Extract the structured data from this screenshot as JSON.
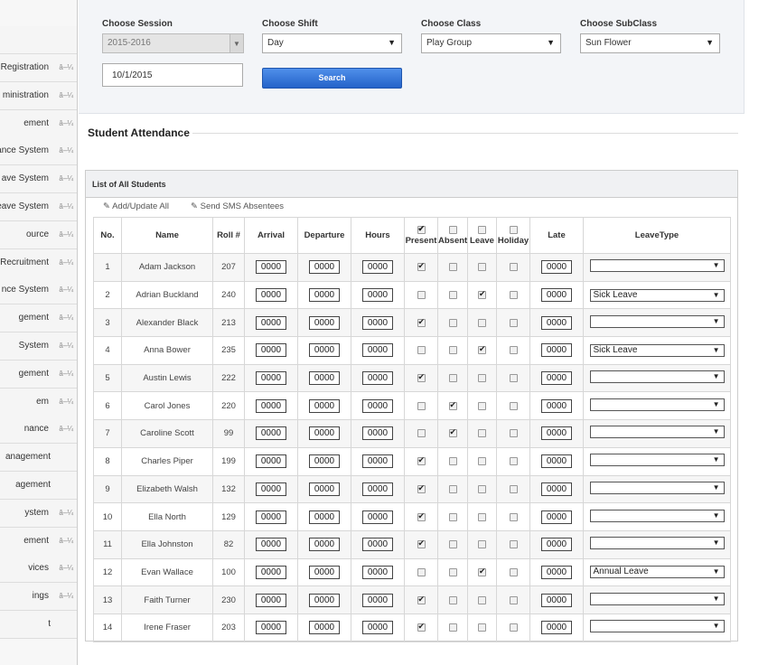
{
  "sidebar": {
    "items": [
      {
        "label": "Registration",
        "arrow": "â–¼"
      },
      {
        "label": "ministration",
        "arrow": "â–¼"
      },
      {
        "label": "ement",
        "arrow": "â–¼"
      },
      {
        "label": "endance System",
        "arrow": "â–¼"
      },
      {
        "label": "ave System",
        "arrow": "â–¼"
      },
      {
        "label": "eave System",
        "arrow": "â–¼"
      },
      {
        "label": "ource",
        "arrow": "â–¼"
      },
      {
        "label": "Recruitment",
        "arrow": "â–¼"
      },
      {
        "label": "nce System",
        "arrow": "â–¼"
      },
      {
        "label": "gement",
        "arrow": "â–¼"
      },
      {
        "label": "System",
        "arrow": "â–¼"
      },
      {
        "label": "gement",
        "arrow": "â–¼"
      },
      {
        "label": "em",
        "arrow": "â–¼"
      },
      {
        "label": "nance",
        "arrow": "â–¼"
      },
      {
        "label": "anagement",
        "arrow": ""
      },
      {
        "label": "agement",
        "arrow": ""
      },
      {
        "label": "ystem",
        "arrow": "â–¼"
      },
      {
        "label": "ement",
        "arrow": "â–¼"
      },
      {
        "label": "vices",
        "arrow": "â–¼"
      },
      {
        "label": "ings",
        "arrow": "â–¼"
      },
      {
        "label": "t",
        "arrow": ""
      }
    ]
  },
  "filters": {
    "session_label": "Choose Session",
    "session_value": "2015-2016",
    "shift_label": "Choose Shift",
    "shift_value": "Day",
    "class_label": "Choose Class",
    "class_value": "Play Group",
    "subclass_label": "Choose SubClass",
    "subclass_value": "Sun Flower",
    "date_value": "10/1/2015",
    "search_label": "Search"
  },
  "page_title": "Student Attendance",
  "card": {
    "title": "List of All Students",
    "add_update": "Add/Update All",
    "send_sms": "Send SMS Absentees"
  },
  "table": {
    "headers": {
      "no": "No.",
      "name": "Name",
      "roll": "Roll #",
      "arrival": "Arrival",
      "departure": "Departure",
      "hours": "Hours",
      "present": "Present",
      "absent": "Absent",
      "leave": "Leave",
      "holiday": "Holiday",
      "late": "Late",
      "leavetype": "LeaveType"
    },
    "header_checks": {
      "present": true,
      "absent": false,
      "leave": false,
      "holiday": false
    },
    "rows": [
      {
        "no": "1",
        "name": "Adam Jackson",
        "roll": "207",
        "arrival": "0000",
        "departure": "0000",
        "hours": "0000",
        "present": true,
        "absent": false,
        "leave": false,
        "holiday": false,
        "late": "0000",
        "leave_type": ""
      },
      {
        "no": "2",
        "name": "Adrian Buckland",
        "roll": "240",
        "arrival": "0000",
        "departure": "0000",
        "hours": "0000",
        "present": false,
        "absent": false,
        "leave": true,
        "holiday": false,
        "late": "0000",
        "leave_type": "Sick Leave"
      },
      {
        "no": "3",
        "name": "Alexander Black",
        "roll": "213",
        "arrival": "0000",
        "departure": "0000",
        "hours": "0000",
        "present": true,
        "absent": false,
        "leave": false,
        "holiday": false,
        "late": "0000",
        "leave_type": ""
      },
      {
        "no": "4",
        "name": "Anna Bower",
        "roll": "235",
        "arrival": "0000",
        "departure": "0000",
        "hours": "0000",
        "present": false,
        "absent": false,
        "leave": true,
        "holiday": false,
        "late": "0000",
        "leave_type": "Sick Leave"
      },
      {
        "no": "5",
        "name": "Austin Lewis",
        "roll": "222",
        "arrival": "0000",
        "departure": "0000",
        "hours": "0000",
        "present": true,
        "absent": false,
        "leave": false,
        "holiday": false,
        "late": "0000",
        "leave_type": ""
      },
      {
        "no": "6",
        "name": "Carol Jones",
        "roll": "220",
        "arrival": "0000",
        "departure": "0000",
        "hours": "0000",
        "present": false,
        "absent": true,
        "leave": false,
        "holiday": false,
        "late": "0000",
        "leave_type": ""
      },
      {
        "no": "7",
        "name": "Caroline Scott",
        "roll": "99",
        "arrival": "0000",
        "departure": "0000",
        "hours": "0000",
        "present": false,
        "absent": true,
        "leave": false,
        "holiday": false,
        "late": "0000",
        "leave_type": ""
      },
      {
        "no": "8",
        "name": "Charles Piper",
        "roll": "199",
        "arrival": "0000",
        "departure": "0000",
        "hours": "0000",
        "present": true,
        "absent": false,
        "leave": false,
        "holiday": false,
        "late": "0000",
        "leave_type": ""
      },
      {
        "no": "9",
        "name": "Elizabeth Walsh",
        "roll": "132",
        "arrival": "0000",
        "departure": "0000",
        "hours": "0000",
        "present": true,
        "absent": false,
        "leave": false,
        "holiday": false,
        "late": "0000",
        "leave_type": ""
      },
      {
        "no": "10",
        "name": "Ella North",
        "roll": "129",
        "arrival": "0000",
        "departure": "0000",
        "hours": "0000",
        "present": true,
        "absent": false,
        "leave": false,
        "holiday": false,
        "late": "0000",
        "leave_type": ""
      },
      {
        "no": "11",
        "name": "Ella Johnston",
        "roll": "82",
        "arrival": "0000",
        "departure": "0000",
        "hours": "0000",
        "present": true,
        "absent": false,
        "leave": false,
        "holiday": false,
        "late": "0000",
        "leave_type": ""
      },
      {
        "no": "12",
        "name": "Evan Wallace",
        "roll": "100",
        "arrival": "0000",
        "departure": "0000",
        "hours": "0000",
        "present": false,
        "absent": false,
        "leave": true,
        "holiday": false,
        "late": "0000",
        "leave_type": "Annual Leave"
      },
      {
        "no": "13",
        "name": "Faith Turner",
        "roll": "230",
        "arrival": "0000",
        "departure": "0000",
        "hours": "0000",
        "present": true,
        "absent": false,
        "leave": false,
        "holiday": false,
        "late": "0000",
        "leave_type": ""
      },
      {
        "no": "14",
        "name": "Irene Fraser",
        "roll": "203",
        "arrival": "0000",
        "departure": "0000",
        "hours": "0000",
        "present": true,
        "absent": false,
        "leave": false,
        "holiday": false,
        "late": "0000",
        "leave_type": ""
      }
    ]
  }
}
